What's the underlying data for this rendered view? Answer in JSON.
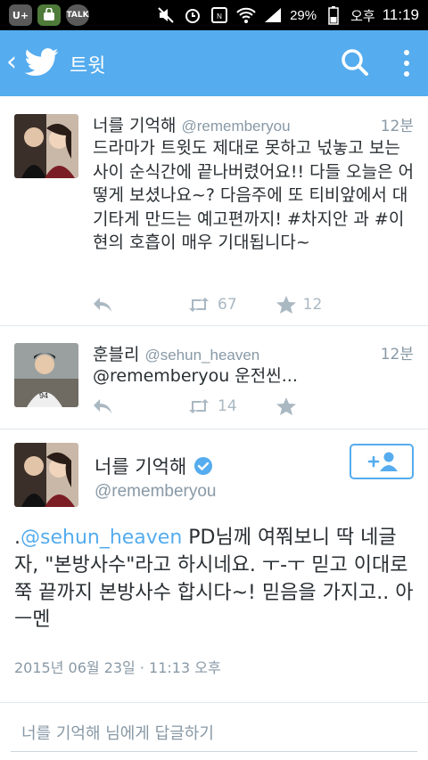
{
  "statusbar": {
    "apps": [
      "U+",
      "",
      "TALK"
    ],
    "battery": "29%",
    "ampm": "오후",
    "time": "11:19"
  },
  "actionbar": {
    "title": "트윗"
  },
  "tweets": [
    {
      "name": "너를 기억해",
      "handle": "@rememberyou",
      "time": "12분",
      "text": "드라마가 트윗도 제대로 못하고 넋놓고 보는 사이 순식간에 끝나버렸어요!! 다들 오늘은 어떻게 보셨나요~? 다음주에 또 티비앞에서 대기타게 만드는 예고편까지! #차지안 과 #이현의 호흡이 매우 기대됩니다~",
      "retweets": "67",
      "favorites": "12"
    },
    {
      "name": "훈블리",
      "handle": "@sehun_heaven",
      "time": "12분",
      "text": "@rememberyou 운전씬...",
      "retweets": "14",
      "favorites": ""
    }
  ],
  "detail": {
    "name": "너를 기억해",
    "handle": "@rememberyou",
    "prefix": ".",
    "mention": "@sehun_heaven",
    "text": " PD님께 여쭤보니 딱 네글자, \"본방사수\"라고 하시네요.  ㅜ-ㅜ 믿고 이대로 쭉 끝까지 본방사수 합시다~! 믿음을 가지고.. 아ㅡ멘",
    "meta": "2015년 06월 23일 · 11:13 오후"
  },
  "reply": {
    "placeholder": "너를 기억해 님에게 답글하기"
  },
  "colors": {
    "brand": "#55acee",
    "muted": "#8899a6",
    "icon_muted": "#aab8c2"
  }
}
